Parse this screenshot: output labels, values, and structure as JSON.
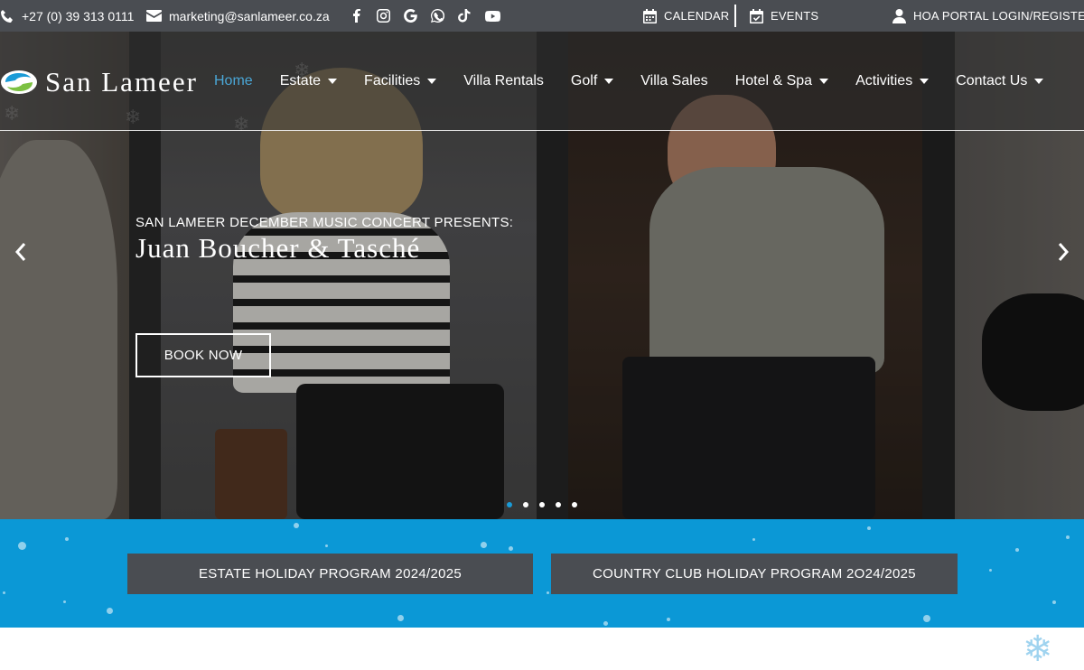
{
  "topbar": {
    "phone": "+27 (0) 39 313 0111",
    "email": "marketing@sanlameer.co.za",
    "social_icons": [
      "facebook-icon",
      "instagram-icon",
      "google-icon",
      "whatsapp-icon",
      "tiktok-icon",
      "youtube-icon"
    ],
    "calendar_label": "CALENDAR",
    "events_label": "EVENTS",
    "portal_label": "HOA PORTAL LOGIN/REGISTER"
  },
  "brand": {
    "name": "San Lameer",
    "logo_colors": [
      "#1a9bd7",
      "#7cc142"
    ]
  },
  "nav": {
    "items": [
      {
        "label": "Home",
        "dropdown": false,
        "active": true
      },
      {
        "label": "Estate",
        "dropdown": true,
        "active": false
      },
      {
        "label": "Facilities",
        "dropdown": true,
        "active": false
      },
      {
        "label": "Villa Rentals",
        "dropdown": false,
        "active": false
      },
      {
        "label": "Golf",
        "dropdown": true,
        "active": false
      },
      {
        "label": "Villa Sales",
        "dropdown": false,
        "active": false
      },
      {
        "label": "Hotel & Spa",
        "dropdown": true,
        "active": false
      },
      {
        "label": "Activities",
        "dropdown": true,
        "active": false
      },
      {
        "label": "Contact Us",
        "dropdown": true,
        "active": false
      }
    ]
  },
  "slide": {
    "subtitle": "SAN LAMEER DECEMBER MUSIC CONCERT PRESENTS:",
    "title": "Juan Boucher & Tasché",
    "button_label": "BOOK NOW",
    "dot_count": 5,
    "active_dot": 0
  },
  "programs": {
    "estate_label": "ESTATE HOLIDAY PROGRAM 2024/2025",
    "country_club_label": "COUNTRY CLUB HOLIDAY PROGRAM 2O24/2025"
  },
  "colors": {
    "topbar_bg": "#4a4d52",
    "accent_blue": "#0b98d6",
    "active_nav": "#4aa6d6"
  }
}
